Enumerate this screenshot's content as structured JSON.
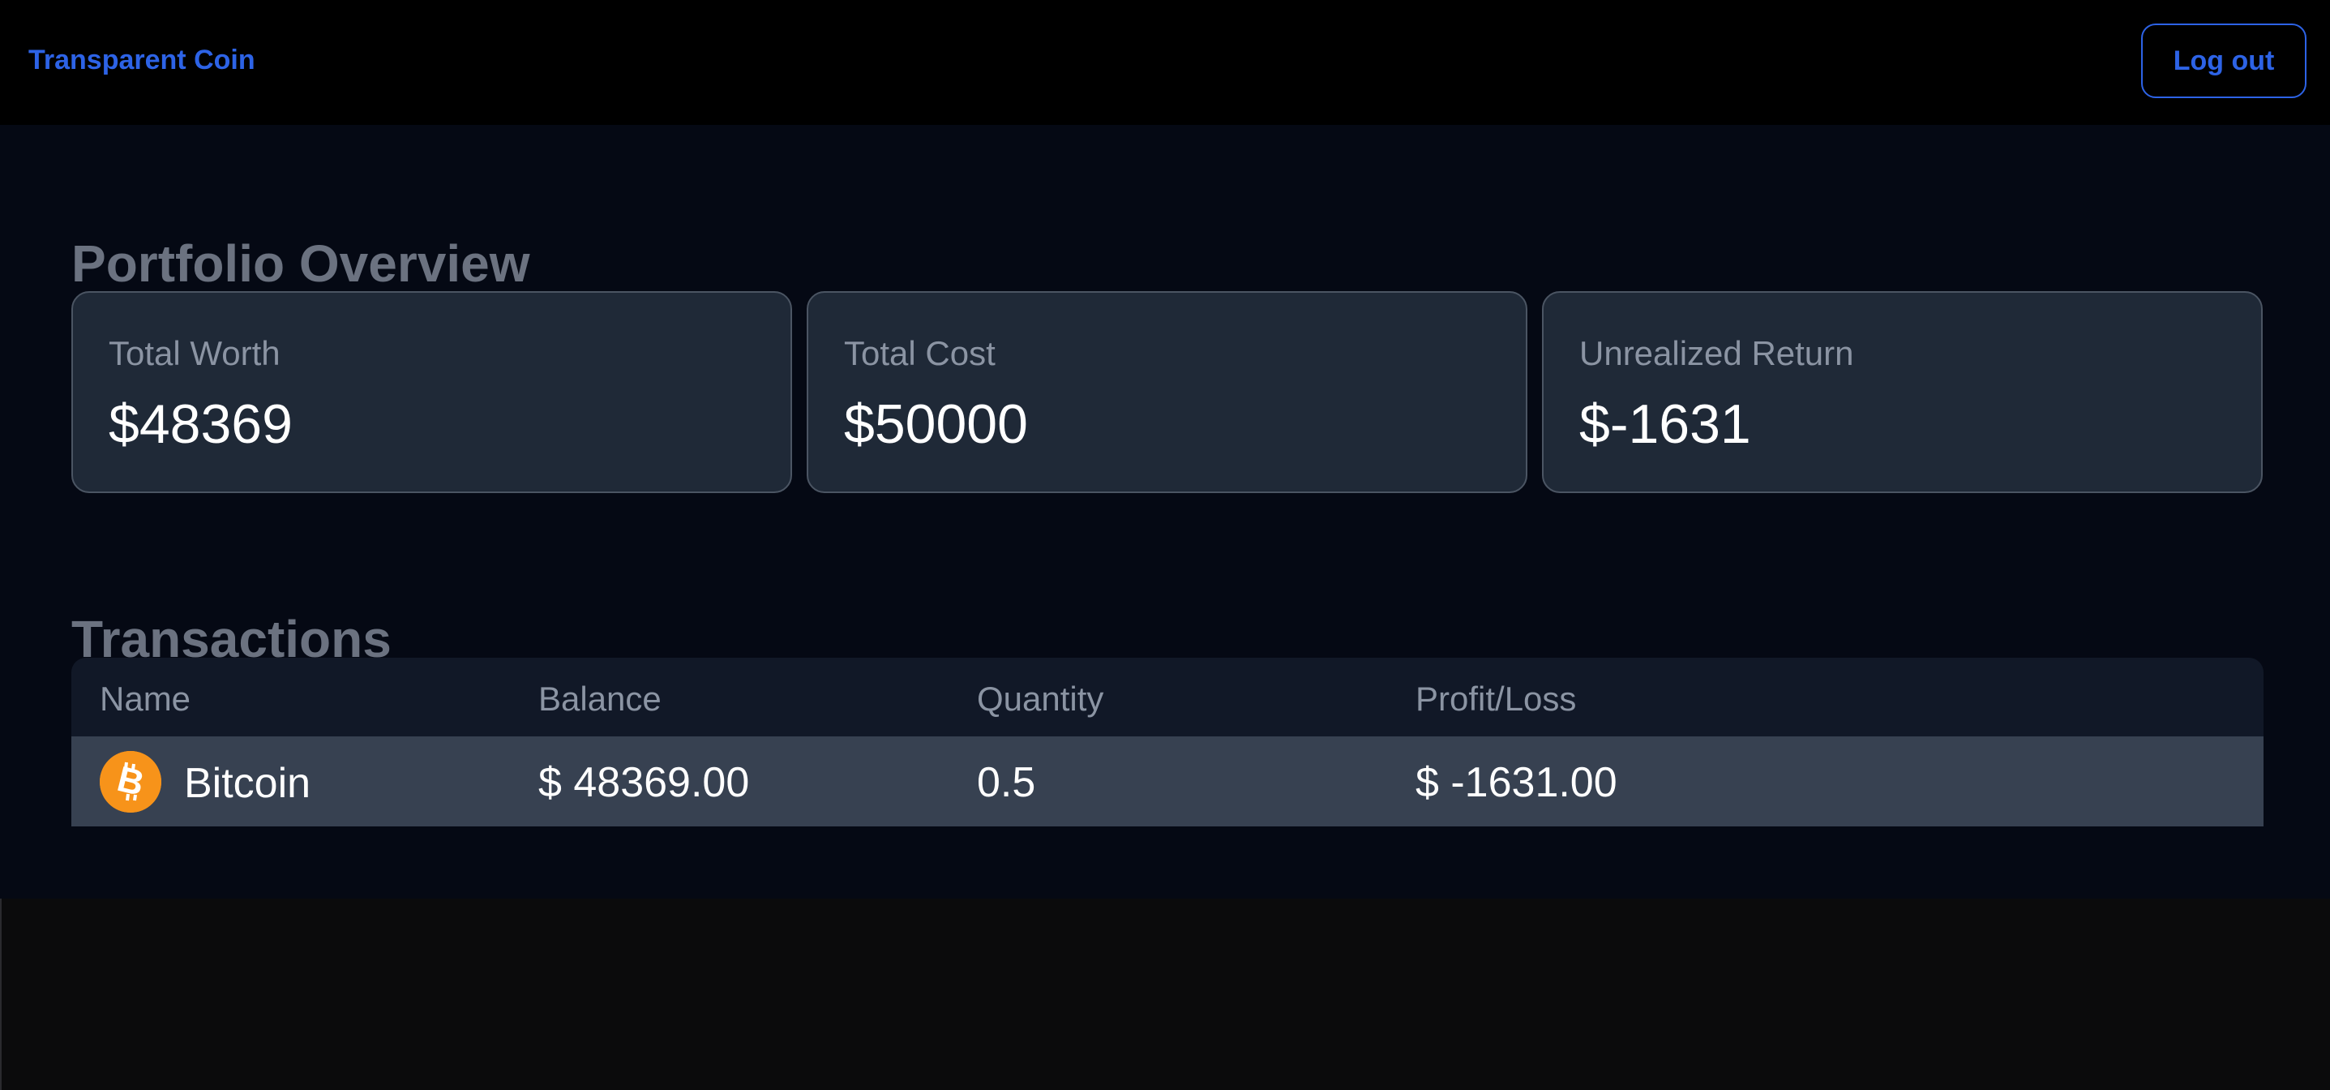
{
  "header": {
    "brand": "Transparent Coin",
    "logout_label": "Log out",
    "brand_color": "#2d63e6"
  },
  "overview": {
    "title": "Portfolio Overview",
    "cards": [
      {
        "label": "Total Worth",
        "value": "$48369"
      },
      {
        "label": "Total Cost",
        "value": "$50000"
      },
      {
        "label": "Unrealized Return",
        "value": "$-1631"
      }
    ]
  },
  "transactions": {
    "title": "Transactions",
    "columns": [
      "Name",
      "Balance",
      "Quantity",
      "Profit/Loss"
    ],
    "rows": [
      {
        "icon": "bitcoin-icon",
        "name": "Bitcoin",
        "balance": "$ 48369.00",
        "quantity": "0.5",
        "profit_loss": "$ -1631.00"
      }
    ]
  }
}
